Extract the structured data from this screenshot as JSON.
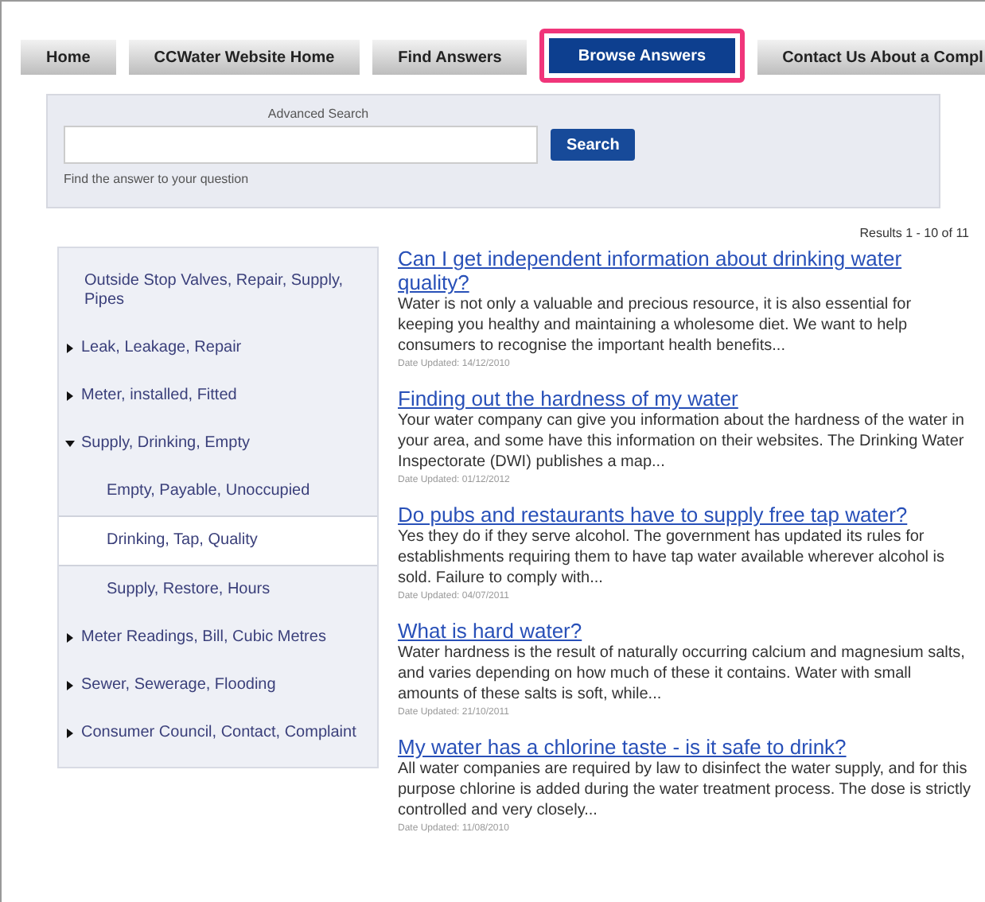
{
  "tabs": [
    {
      "label": "Home",
      "selected": false
    },
    {
      "label": "CCWater Website Home",
      "selected": false
    },
    {
      "label": "Find Answers",
      "selected": false
    },
    {
      "label": "Browse Answers",
      "selected": true
    },
    {
      "label": "Contact Us About a Compl",
      "selected": false
    }
  ],
  "search": {
    "heading": "Advanced Search",
    "button": "Search",
    "hint": "Find the answer to your question"
  },
  "results_count": "Results 1 - 10 of 11",
  "sidebar": {
    "items": [
      {
        "label": "Outside Stop Valves, Repair, Supply, Pipes",
        "kind": "leaf",
        "selected": false
      },
      {
        "label": "Leak, Leakage, Repair",
        "kind": "collapsed",
        "selected": false
      },
      {
        "label": "Meter, installed, Fitted",
        "kind": "collapsed",
        "selected": false
      },
      {
        "label": "Supply, Drinking, Empty",
        "kind": "expanded",
        "selected": false,
        "children": [
          {
            "label": "Empty, Payable, Unoccupied",
            "selected": false
          },
          {
            "label": "Drinking, Tap, Quality",
            "selected": true
          },
          {
            "label": "Supply, Restore, Hours",
            "selected": false
          }
        ]
      },
      {
        "label": "Meter Readings, Bill, Cubic Metres",
        "kind": "collapsed",
        "selected": false
      },
      {
        "label": "Sewer, Sewerage, Flooding",
        "kind": "collapsed",
        "selected": false
      },
      {
        "label": "Consumer Council, Contact, Complaint",
        "kind": "collapsed",
        "selected": false
      }
    ]
  },
  "results": [
    {
      "title": "Can I get independent information about drinking water quality?",
      "snippet": "Water is not only a valuable and precious resource, it is also essential for keeping you healthy and maintaining a wholesome diet. We want to help consumers to recognise the important health benefits...",
      "date": "Date Updated: 14/12/2010"
    },
    {
      "title": "Finding out the hardness of my water",
      "snippet": "Your water company can give you information about the hardness of the water in your area, and some have this information on their websites. The Drinking Water Inspectorate (DWI) publishes a map...",
      "date": "Date Updated: 01/12/2012"
    },
    {
      "title": "Do pubs and restaurants have to supply free tap water?",
      "snippet": "Yes they do if they serve alcohol.  The government has updated its rules for establishments requiring them to have tap water available wherever alcohol is sold.  Failure to comply with...",
      "date": "Date Updated: 04/07/2011"
    },
    {
      "title": "What is hard water?",
      "snippet": "Water hardness is the result of naturally occurring calcium and magnesium salts, and varies depending on how much of these it contains. Water with small amounts of these salts is soft, while...",
      "date": "Date Updated: 21/10/2011"
    },
    {
      "title": "My water has a chlorine taste - is it safe to drink?",
      "snippet": "All water companies are required by law to disinfect the water supply, and for this purpose chlorine is added during the water treatment process. The dose is strictly controlled and very closely...",
      "date": "Date Updated: 11/08/2010"
    }
  ]
}
